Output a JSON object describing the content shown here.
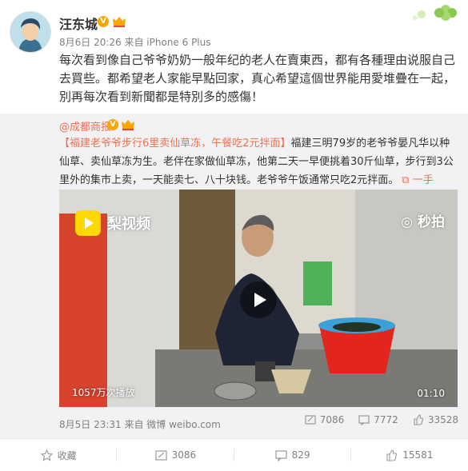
{
  "post": {
    "username": "汪东城",
    "verified_badge": "V",
    "meta": "8月6日 20:26 来自 iPhone 6 Plus",
    "text": "每次看到像自己爷爷奶奶一般年纪的老人在賣東西，都有各種理由说服自己去買些。都希望老人家能早點回家，真心希望這個世界能用愛堆疊在一起，別再每次看到新聞都是特別多的感傷！"
  },
  "repost": {
    "author": "@成都商报",
    "verified_badge": "V",
    "topic": "【福建老爷爷步行6里卖仙草冻，午餐吃2元拌面】",
    "body": "福建三明79岁的老爷爷晏凡华以种仙草、卖仙草冻为生。老伴在家做仙草冻，他第二天一早便挑着30斤仙草，步行到3公里外的集市上卖，一天能卖七、八十块钱。老爷爷午饭通常只吃2元拌面。",
    "video_link": "一手video的秒拍视频",
    "video": {
      "brand": "梨视频",
      "watermark": "秒拍",
      "views": "1057万次播放",
      "duration": "01:10"
    },
    "footer": "8月5日 23:31 来自 微博 weibo.com",
    "stats": {
      "reposts": "7086",
      "comments": "7772",
      "likes": "33528"
    }
  },
  "actions": {
    "favorite": "收藏",
    "repost": "3086",
    "comment": "829",
    "like": "15581"
  },
  "icons": [
    "clover-icon",
    "crown-icon",
    "repost-icon",
    "comment-icon",
    "like-icon",
    "star-icon",
    "play-icon",
    "video-link-icon"
  ],
  "colors": {
    "link": "#eb7350",
    "verified": "#f7a600",
    "repost_bg": "#f2f2f5"
  }
}
